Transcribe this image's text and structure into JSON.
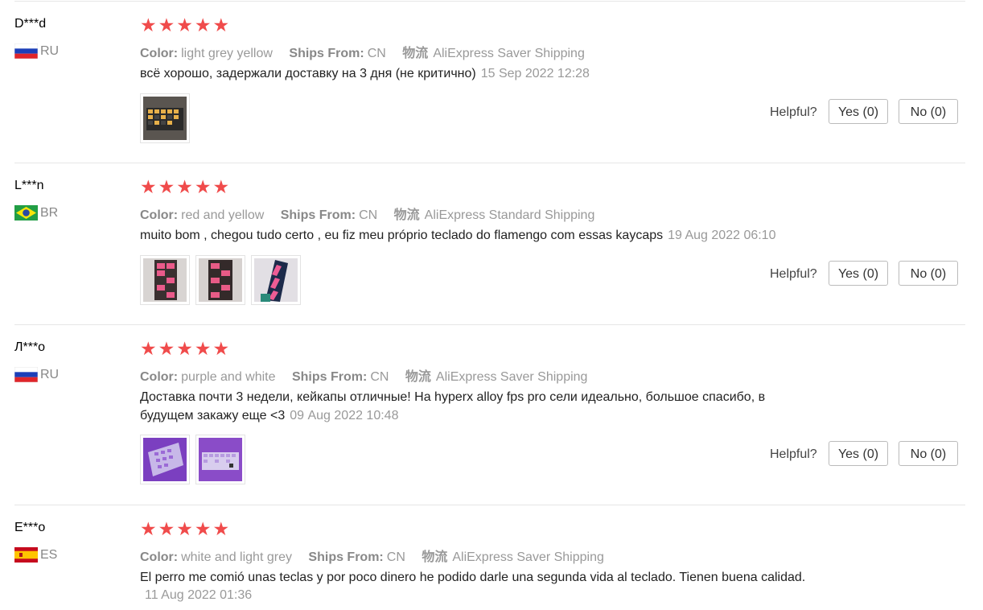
{
  "labels": {
    "color": "Color:",
    "ships_from": "Ships From:",
    "logistics": "物流",
    "helpful": "Helpful?"
  },
  "reviews": [
    {
      "user": "D***d",
      "country": "RU",
      "flag_icon": "russia-flag-icon",
      "stars": 5,
      "color": "light grey yellow",
      "ships_from": "CN",
      "shipping": "AliExpress Saver Shipping",
      "text": "всё хорошо, задержали доставку на 3 дня (не критично)",
      "date": "15 Sep 2022 12:28",
      "photos": [
        "keyboard-photo"
      ],
      "yes": "Yes (0)",
      "no": "No (0)"
    },
    {
      "user": "L***n",
      "country": "BR",
      "flag_icon": "brazil-flag-icon",
      "stars": 5,
      "color": "red and yellow",
      "ships_from": "CN",
      "shipping": "AliExpress Standard Shipping",
      "text": "muito bom , chegou tudo certo , eu fiz meu próprio teclado do flamengo com essas kaycaps",
      "date": "19 Aug 2022 06:10",
      "photos": [
        "keyboard-photo",
        "keyboard-photo",
        "keyboard-photo"
      ],
      "yes": "Yes (0)",
      "no": "No (0)"
    },
    {
      "user": "Л***о",
      "country": "RU",
      "flag_icon": "russia-flag-icon",
      "stars": 5,
      "color": "purple and white",
      "ships_from": "CN",
      "shipping": "AliExpress Saver Shipping",
      "text_line1": "Доставка почти 3 недели, кейкапы отличные! На hyperx alloy fps pro сели идеально, большое спасибо, в",
      "text_line2": "будущем закажу еще <3",
      "date": "09 Aug 2022 10:48",
      "photos": [
        "keyboard-photo",
        "keyboard-photo"
      ],
      "yes": "Yes (0)",
      "no": "No (0)"
    },
    {
      "user": "E***o",
      "country": "ES",
      "flag_icon": "spain-flag-icon",
      "stars": 5,
      "color": "white and light grey",
      "ships_from": "CN",
      "shipping": "AliExpress Saver Shipping",
      "text": "El perro me comió unas teclas y por poco dinero he podido darle una segunda vida al teclado. Tienen buena calidad.",
      "date": "11 Aug 2022 01:36"
    }
  ],
  "colors": {
    "star": "#f04b4b",
    "muted": "#999999"
  }
}
